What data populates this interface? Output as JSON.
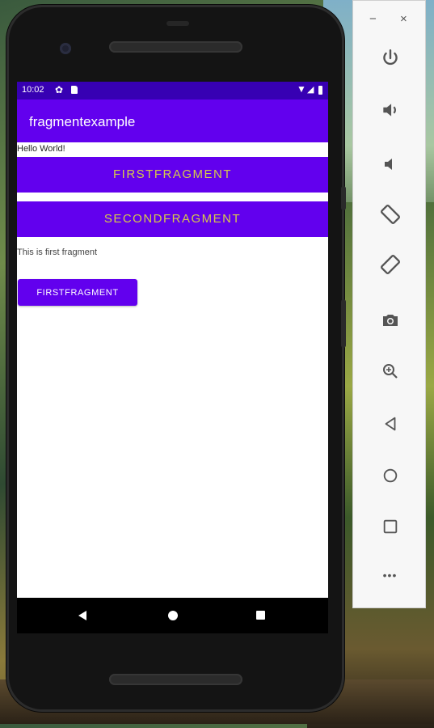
{
  "status_bar": {
    "time": "10:02",
    "gear_icon": "gear-icon",
    "sd_icon": "sd-card-icon",
    "wifi_icon": "wifi-icon",
    "signal_icon": "signal-icon",
    "battery_icon": "battery-icon"
  },
  "app_bar": {
    "title": "fragmentexample",
    "color": "#6200ee"
  },
  "main": {
    "hello_text": "Hello World!",
    "first_fragment_button": "FIRSTFRAGMENT",
    "second_fragment_button": "SECONDFRAGMENT",
    "fragment_text": "This is first fragment",
    "fragment_button": "FIRSTFRAGMENT"
  },
  "nav_bar": {
    "back": "back-icon",
    "home": "home-icon",
    "recents": "recents-icon"
  },
  "emulator_panel": {
    "minimize": "−",
    "close": "×",
    "tools": [
      "power-icon",
      "volume-up-icon",
      "volume-down-icon",
      "rotate-left-icon",
      "rotate-right-icon",
      "camera-icon",
      "zoom-icon",
      "back-icon",
      "home-icon",
      "overview-icon",
      "more-icon"
    ],
    "more_label": "•••"
  },
  "colors": {
    "primary": "#6200ee",
    "primary_dark": "#3700b3",
    "button_text_accent": "#d6c94a"
  }
}
